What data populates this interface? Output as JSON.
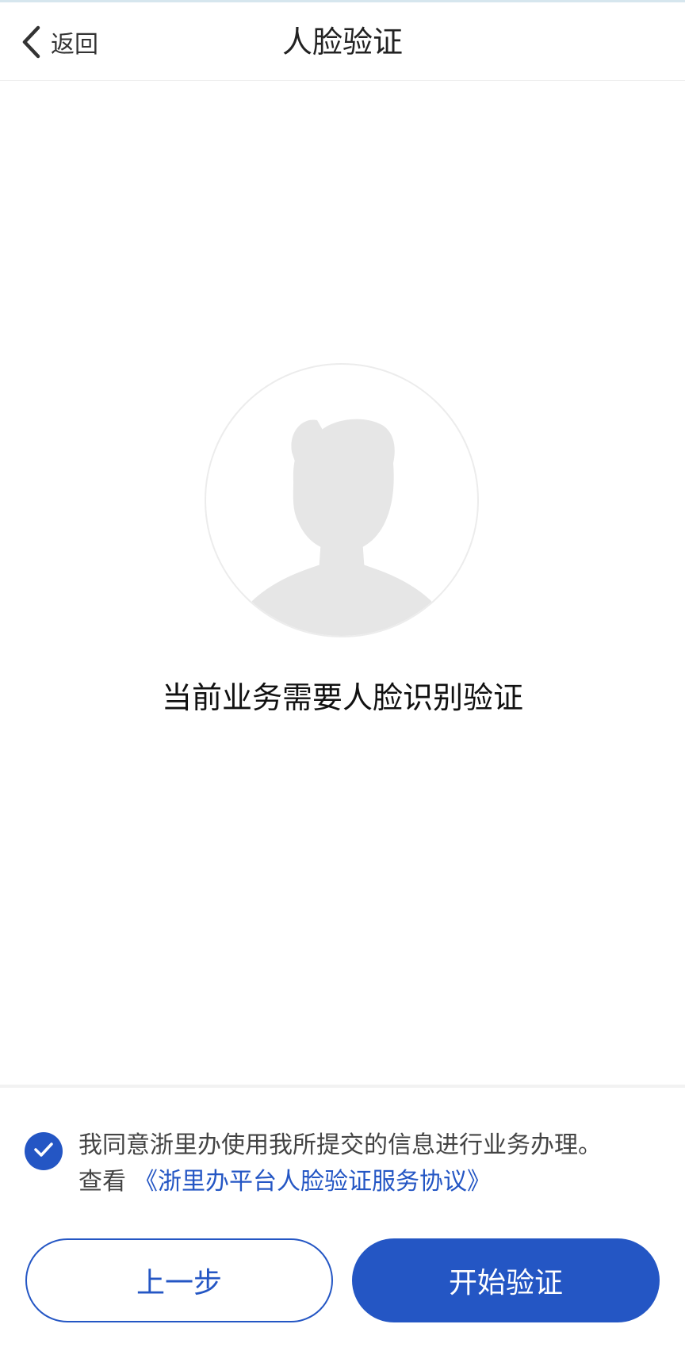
{
  "navbar": {
    "back_label": "返回",
    "title": "人脸验证",
    "back_icon": "chevron-left-icon"
  },
  "main": {
    "avatar_icon": "person-silhouette-icon",
    "prompt": "当前业务需要人脸识别验证"
  },
  "agreement": {
    "checked": true,
    "check_icon": "check-icon",
    "text": "我同意浙里办使用我所提交的信息进行业务办理。",
    "view_label": "查看",
    "link_text": "《浙里办平台人脸验证服务协议》"
  },
  "buttons": {
    "prev_label": "上一步",
    "start_label": "开始验证"
  },
  "colors": {
    "primary": "#2456c4",
    "silhouette": "#e6e6e6",
    "text": "#222222"
  }
}
